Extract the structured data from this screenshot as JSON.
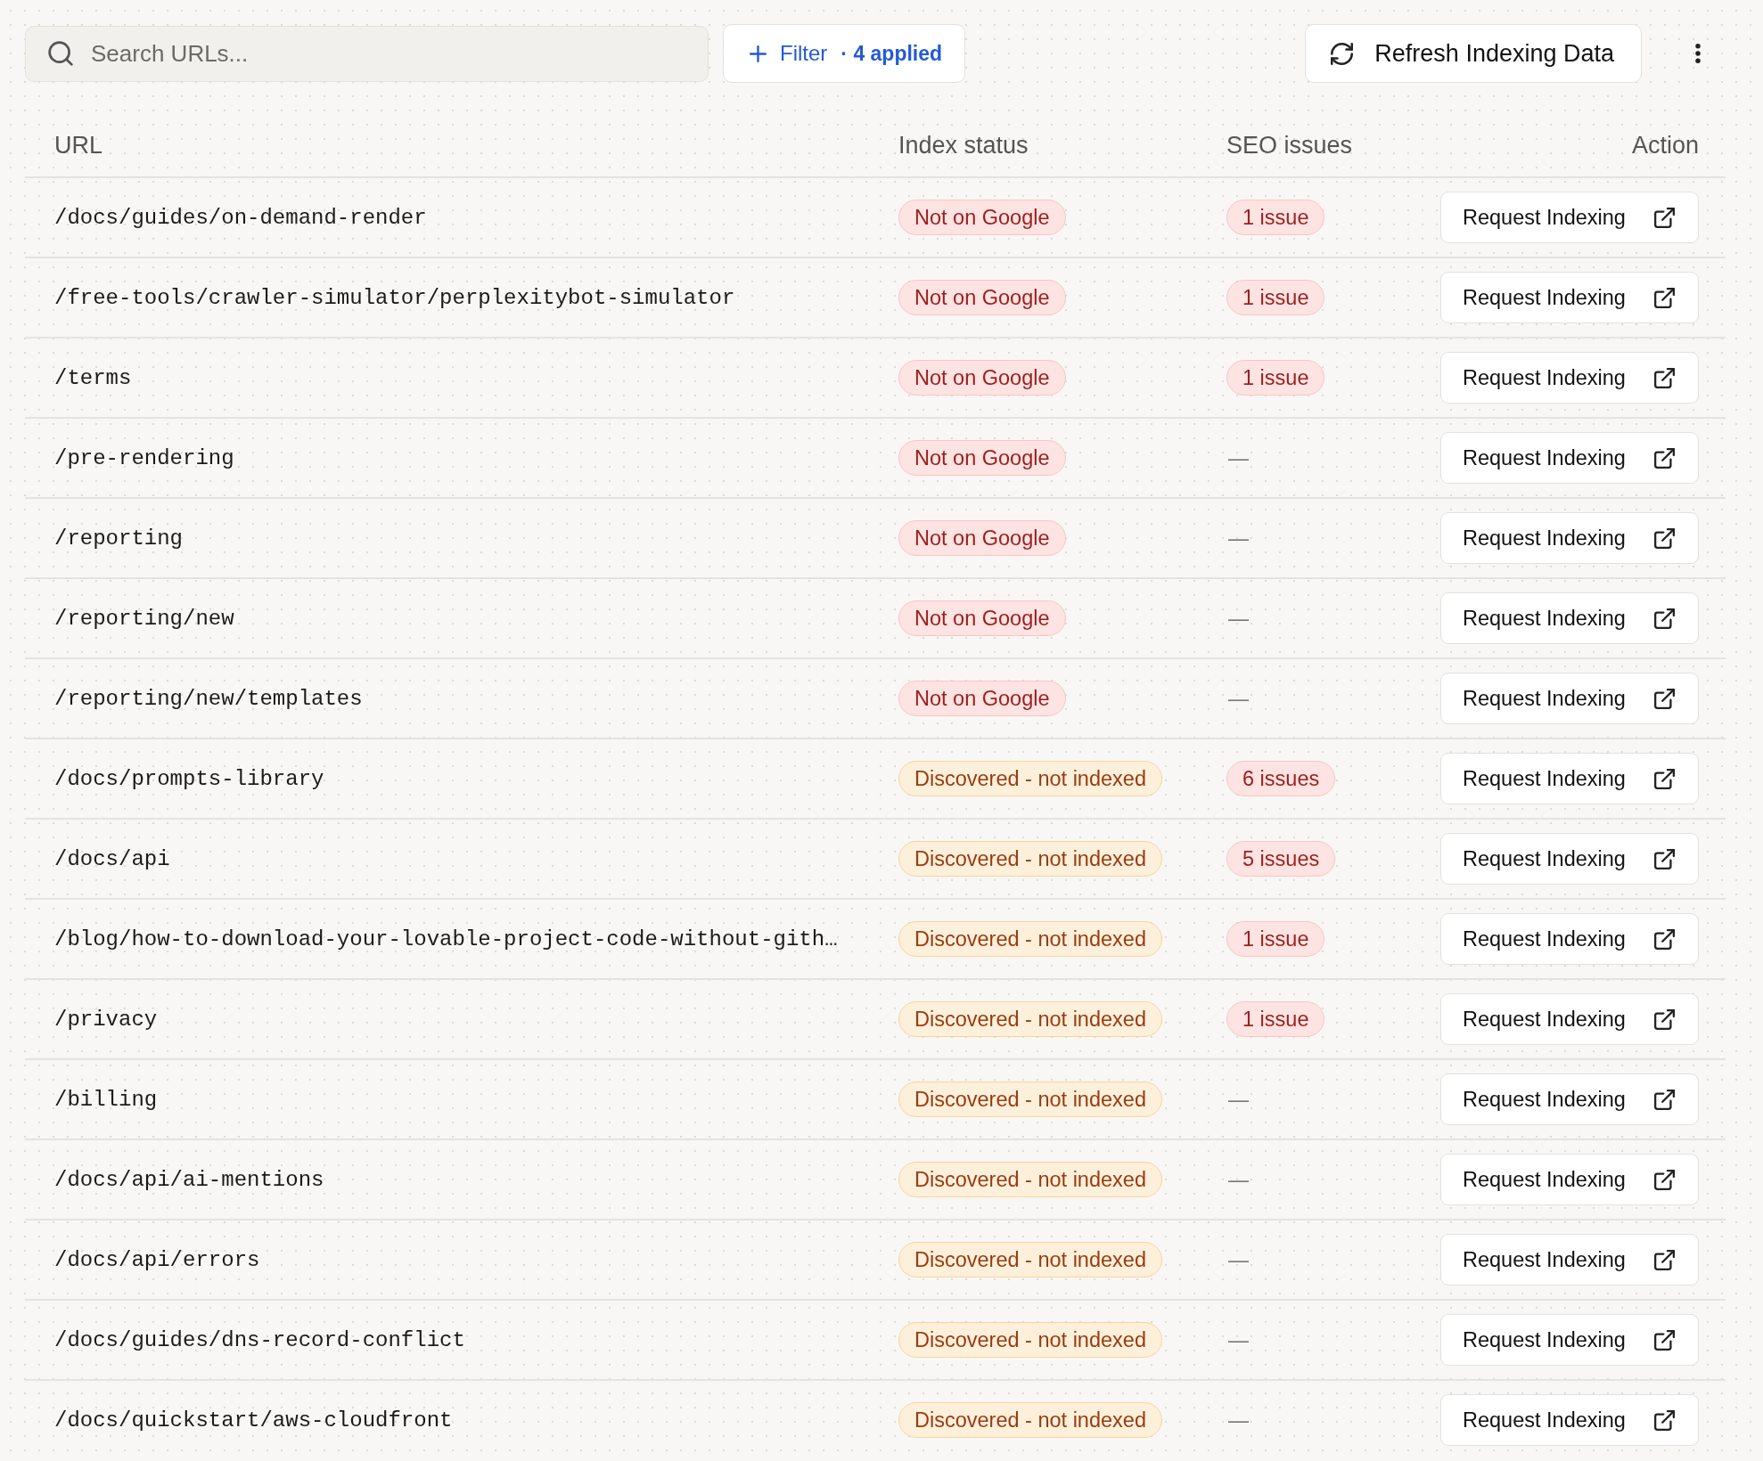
{
  "search": {
    "placeholder": "Search URLs..."
  },
  "filter": {
    "label": "Filter",
    "applied": "· 4 applied"
  },
  "refresh": {
    "label": "Refresh Indexing Data"
  },
  "table": {
    "columns": [
      "URL",
      "Index status",
      "SEO issues",
      "Action"
    ],
    "rows": [
      {
        "url": "/docs/guides/on-demand-render",
        "status": {
          "kind": "error",
          "label": "Not on Google"
        },
        "seo": {
          "kind": "badge",
          "label": "1 issue"
        },
        "action": "Request Indexing"
      },
      {
        "url": "/free-tools/crawler-simulator/perplexitybot-simulator",
        "status": {
          "kind": "error",
          "label": "Not on Google"
        },
        "seo": {
          "kind": "badge",
          "label": "1 issue"
        },
        "action": "Request Indexing"
      },
      {
        "url": "/terms",
        "status": {
          "kind": "error",
          "label": "Not on Google"
        },
        "seo": {
          "kind": "badge",
          "label": "1 issue"
        },
        "action": "Request Indexing"
      },
      {
        "url": "/pre-rendering",
        "status": {
          "kind": "error",
          "label": "Not on Google"
        },
        "seo": {
          "kind": "none",
          "label": "—"
        },
        "action": "Request Indexing"
      },
      {
        "url": "/reporting",
        "status": {
          "kind": "error",
          "label": "Not on Google"
        },
        "seo": {
          "kind": "none",
          "label": "—"
        },
        "action": "Request Indexing"
      },
      {
        "url": "/reporting/new",
        "status": {
          "kind": "error",
          "label": "Not on Google"
        },
        "seo": {
          "kind": "none",
          "label": "—"
        },
        "action": "Request Indexing"
      },
      {
        "url": "/reporting/new/templates",
        "status": {
          "kind": "error",
          "label": "Not on Google"
        },
        "seo": {
          "kind": "none",
          "label": "—"
        },
        "action": "Request Indexing"
      },
      {
        "url": "/docs/prompts-library",
        "status": {
          "kind": "warning",
          "label": "Discovered - not indexed"
        },
        "seo": {
          "kind": "badge",
          "label": "6 issues"
        },
        "action": "Request Indexing"
      },
      {
        "url": "/docs/api",
        "status": {
          "kind": "warning",
          "label": "Discovered - not indexed"
        },
        "seo": {
          "kind": "badge",
          "label": "5 issues"
        },
        "action": "Request Indexing"
      },
      {
        "url": "/blog/how-to-download-your-lovable-project-code-without-gith…",
        "status": {
          "kind": "warning",
          "label": "Discovered - not indexed"
        },
        "seo": {
          "kind": "badge",
          "label": "1 issue"
        },
        "action": "Request Indexing"
      },
      {
        "url": "/privacy",
        "status": {
          "kind": "warning",
          "label": "Discovered - not indexed"
        },
        "seo": {
          "kind": "badge",
          "label": "1 issue"
        },
        "action": "Request Indexing"
      },
      {
        "url": "/billing",
        "status": {
          "kind": "warning",
          "label": "Discovered - not indexed"
        },
        "seo": {
          "kind": "none",
          "label": "—"
        },
        "action": "Request Indexing"
      },
      {
        "url": "/docs/api/ai-mentions",
        "status": {
          "kind": "warning",
          "label": "Discovered - not indexed"
        },
        "seo": {
          "kind": "none",
          "label": "—"
        },
        "action": "Request Indexing"
      },
      {
        "url": "/docs/api/errors",
        "status": {
          "kind": "warning",
          "label": "Discovered - not indexed"
        },
        "seo": {
          "kind": "none",
          "label": "—"
        },
        "action": "Request Indexing"
      },
      {
        "url": "/docs/guides/dns-record-conflict",
        "status": {
          "kind": "warning",
          "label": "Discovered - not indexed"
        },
        "seo": {
          "kind": "none",
          "label": "—"
        },
        "action": "Request Indexing"
      },
      {
        "url": "/docs/quickstart/aws-cloudfront",
        "status": {
          "kind": "warning",
          "label": "Discovered - not indexed"
        },
        "seo": {
          "kind": "none",
          "label": "—"
        },
        "action": "Request Indexing"
      }
    ]
  }
}
